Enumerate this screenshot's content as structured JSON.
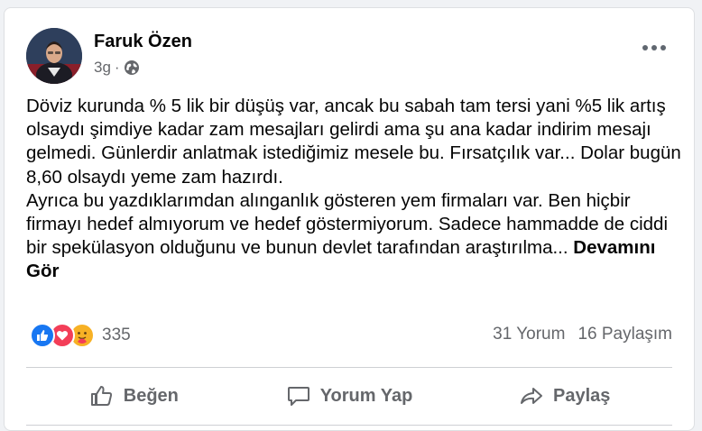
{
  "post": {
    "author_name": "Faruk Özen",
    "time": "3g",
    "separator": "·",
    "text": "Döviz kurunda % 5 lik bir düşüş var, ancak bu sabah tam tersi yani %5 lik artış olsaydı şimdiye kadar zam mesajları gelirdi ama şu ana kadar indirim mesajı gelmedi. Günlerdir anlatmak istediğimiz mesele bu. Fırsatçılık var... Dolar bugün 8,60 olsaydı yeme zam hazırdı.\nAyrıca bu yazdıklarımdan alınganlık gösteren yem firmaları var. Ben hiçbir firmayı hedef almıyorum ve hedef göstermiyorum. Sadece hammadde de ciddi bir spekülasyon olduğunu ve bunun devlet tarafından araştırılma... ",
    "see_more": "Devamını Gör"
  },
  "reactions": {
    "types": [
      "like-icon",
      "love-icon",
      "care-icon"
    ],
    "count": "335"
  },
  "stats": {
    "comments": "31 Yorum",
    "shares": "16 Paylaşım"
  },
  "actions": {
    "like": "Beğen",
    "comment": "Yorum Yap",
    "share": "Paylaş"
  },
  "colors": {
    "like_blue": "#1877f2",
    "love_red": "#f33e58",
    "care_yellow": "#f7b125",
    "secondary_text": "#65676b"
  }
}
